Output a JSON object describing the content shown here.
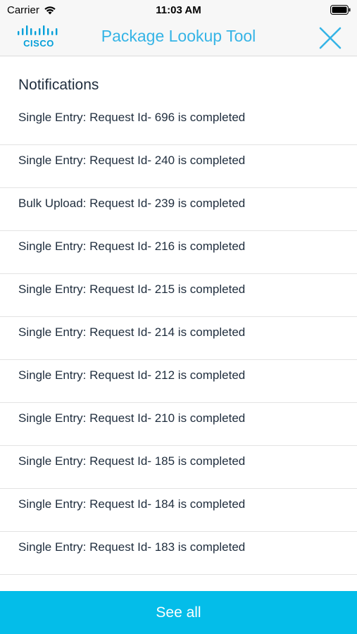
{
  "status_bar": {
    "carrier": "Carrier",
    "time": "11:03 AM"
  },
  "header": {
    "logo_text": "CISCO",
    "title": "Package Lookup Tool",
    "close_icon": "close-icon",
    "accent_color": "#35b4e6"
  },
  "notifications": {
    "title": "Notifications",
    "items": [
      {
        "label": "Single Entry: Request Id- 696 is completed"
      },
      {
        "label": "Single Entry: Request Id- 240 is completed"
      },
      {
        "label": "Bulk Upload: Request Id- 239 is completed"
      },
      {
        "label": "Single Entry: Request Id- 216 is completed"
      },
      {
        "label": "Single Entry: Request Id- 215 is completed"
      },
      {
        "label": "Single Entry: Request Id- 214 is completed"
      },
      {
        "label": "Single Entry: Request Id- 212 is completed"
      },
      {
        "label": "Single Entry: Request Id- 210 is completed"
      },
      {
        "label": "Single Entry: Request Id- 185 is completed"
      },
      {
        "label": "Single Entry: Request Id- 184 is completed"
      },
      {
        "label": "Single Entry: Request Id- 183 is completed"
      },
      {
        "label": ""
      }
    ]
  },
  "footer": {
    "see_all_label": "See all",
    "button_color": "#04bde9"
  }
}
